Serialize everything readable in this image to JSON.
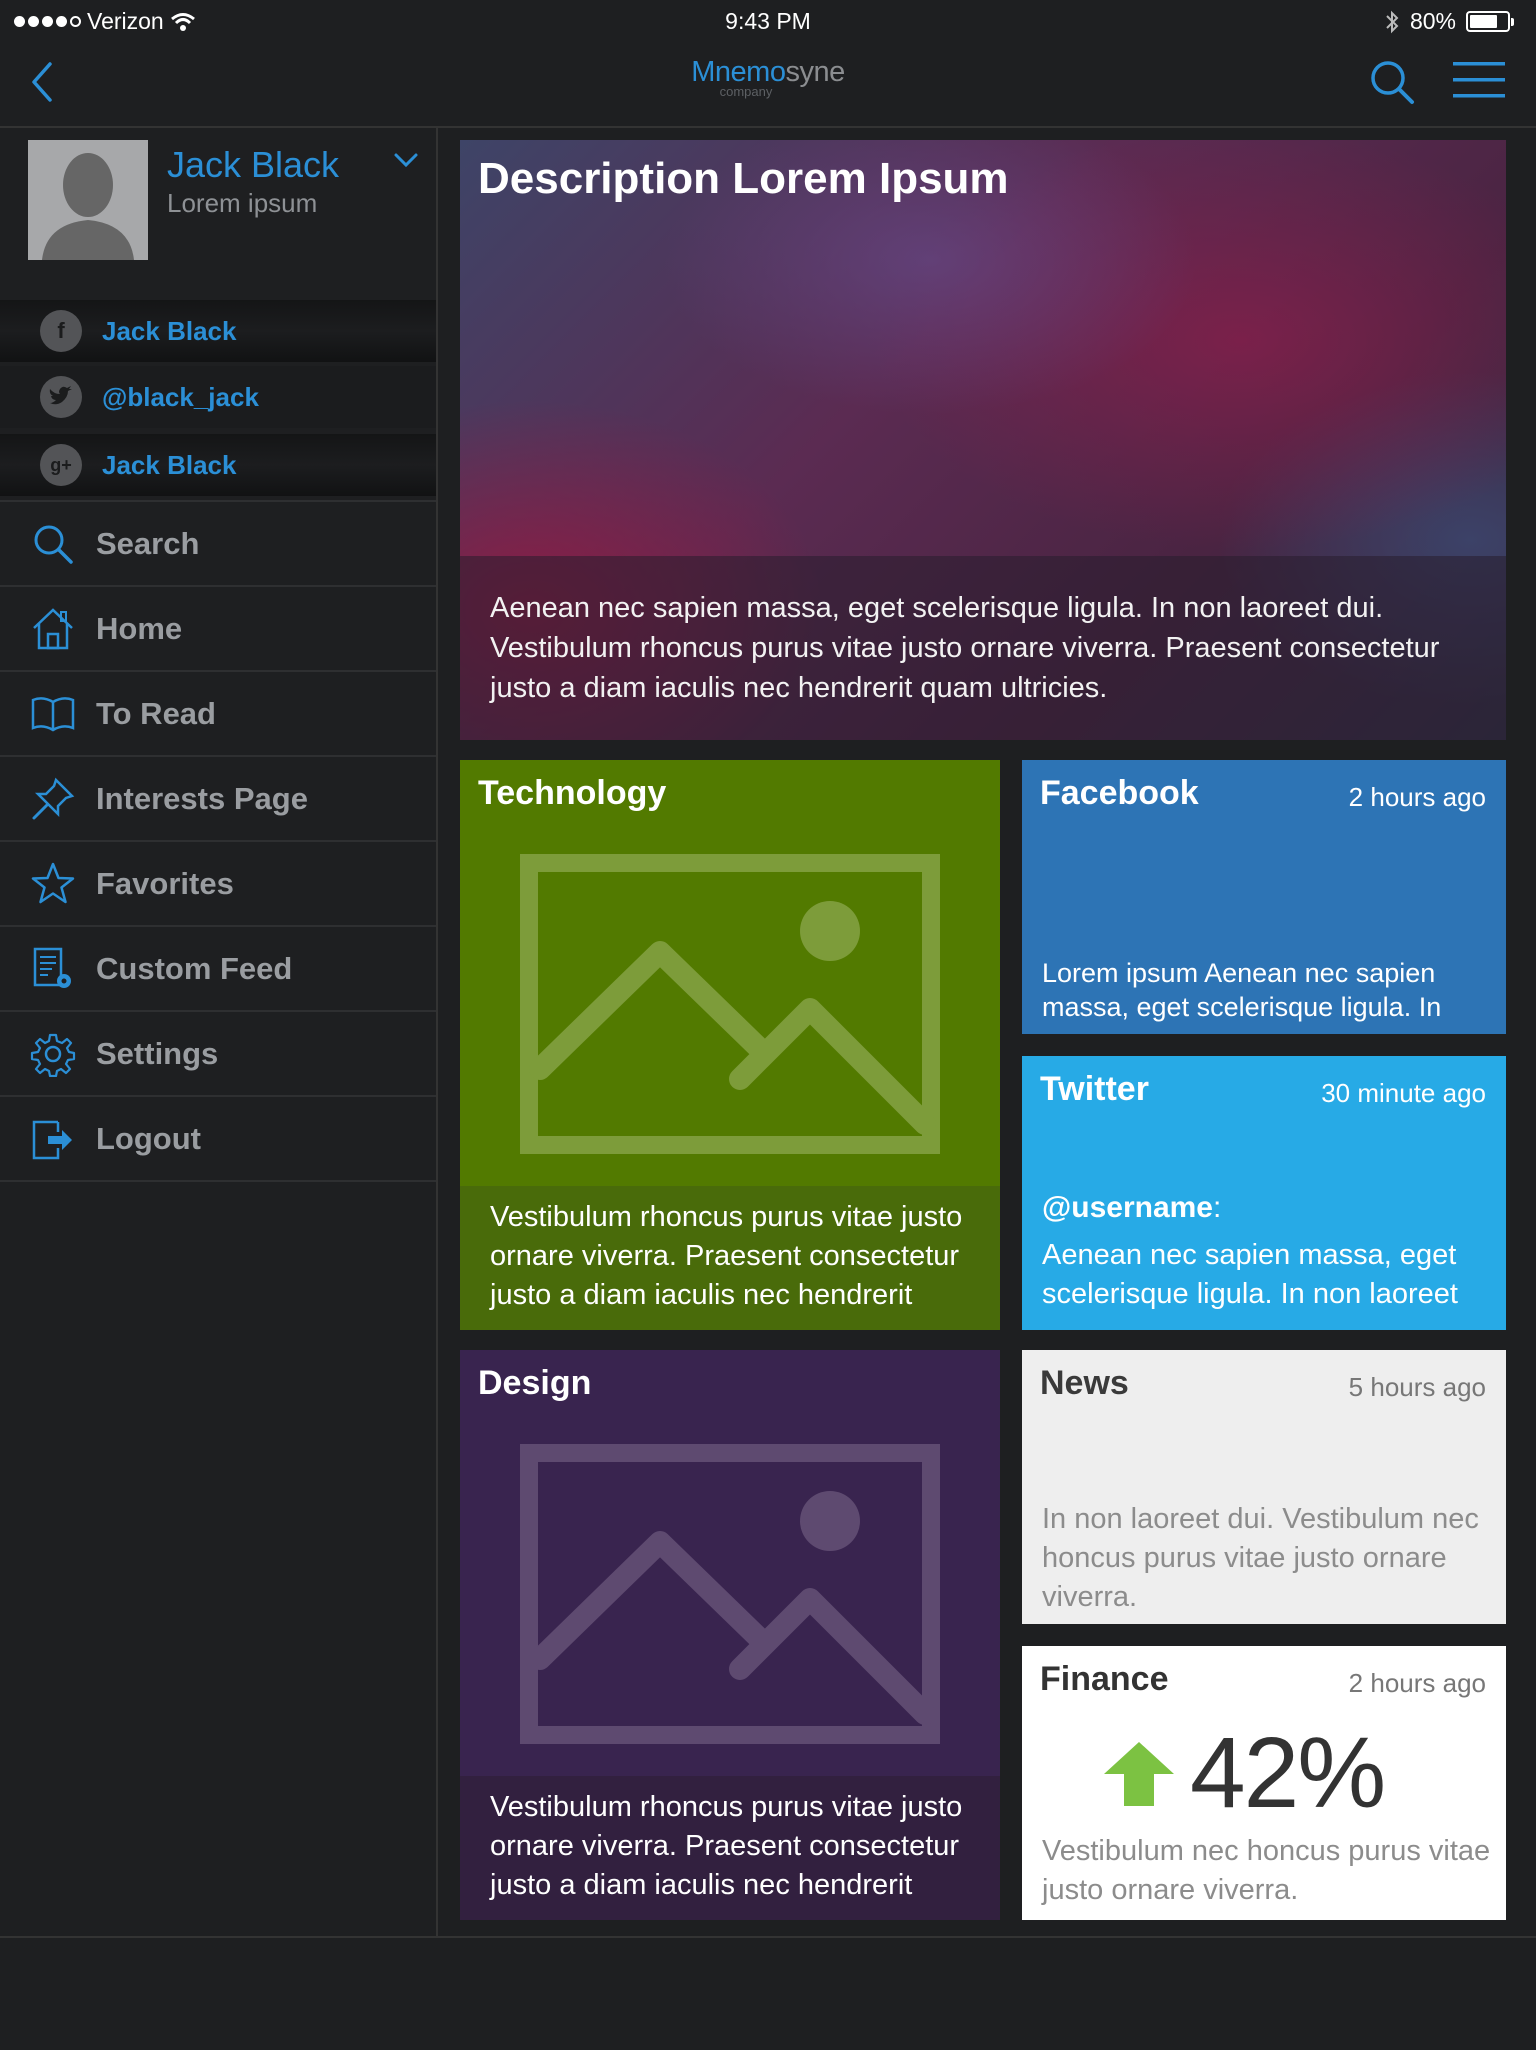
{
  "status": {
    "carrier": "Verizon",
    "time": "9:43 PM",
    "battery": "80%",
    "battery_level": 0.8
  },
  "nav": {
    "brand_part1": "Mnemo",
    "brand_part2": "syne",
    "brand_sub": "company"
  },
  "profile": {
    "name": "Jack Black",
    "subtitle": "Lorem ipsum"
  },
  "social": [
    {
      "label": "Jack Black",
      "icon": "facebook-icon"
    },
    {
      "label": "@black_jack",
      "icon": "twitter-icon"
    },
    {
      "label": "Jack Black",
      "icon": "google-plus-icon"
    }
  ],
  "menu": [
    {
      "label": "Search",
      "icon": "search-icon"
    },
    {
      "label": "Home",
      "icon": "home-icon"
    },
    {
      "label": "To Read",
      "icon": "book-icon"
    },
    {
      "label": "Interests Page",
      "icon": "pin-icon"
    },
    {
      "label": "Favorites",
      "icon": "star-icon"
    },
    {
      "label": "Custom Feed",
      "icon": "feed-settings-icon"
    },
    {
      "label": "Settings",
      "icon": "gear-icon"
    },
    {
      "label": "Logout",
      "icon": "logout-icon"
    }
  ],
  "hero": {
    "title": "Description Lorem Ipsum",
    "text": "Aenean nec sapien massa, eget scelerisque ligula. In non laoreet dui. Vestibulum rhoncus purus vitae justo ornare viverra. Praesent consectetur justo a diam iaculis nec hendrerit quam ultricies."
  },
  "tiles": {
    "technology": {
      "title": "Technology",
      "text": "Vestibulum rhoncus purus vitae justo ornare viverra. Praesent consectetur justo a diam iaculis nec hendrerit"
    },
    "design": {
      "title": "Design",
      "text": "Vestibulum rhoncus purus vitae justo ornare viverra. Praesent consectetur justo a diam iaculis nec hendrerit"
    },
    "facebook": {
      "title": "Facebook",
      "time": "2 hours ago",
      "text": "Lorem ipsum Aenean nec sapien massa, eget scelerisque ligula. In non"
    },
    "twitter": {
      "title": "Twitter",
      "time": "30 minute ago",
      "user": "@username",
      "colon": ":",
      "text": "Aenean nec sapien massa, eget scelerisque ligula. In non laoreet"
    },
    "news": {
      "title": "News",
      "time": "5 hours ago",
      "text": "In non laoreet dui. Vestibulum nec honcus purus vitae justo ornare viverra."
    },
    "finance": {
      "title": "Finance",
      "time": "2 hours ago",
      "value": "42%",
      "text": "Vestibulum nec honcus purus vitae justo ornare viverra."
    }
  },
  "colors": {
    "accent": "#2b8fd6",
    "technology": "#527a00",
    "design": "#39244f",
    "facebook": "#2d74b5",
    "twitter": "#27aae6",
    "news": "#eeeeee",
    "finance": "#ffffff",
    "finance_up": "#7cc242"
  }
}
